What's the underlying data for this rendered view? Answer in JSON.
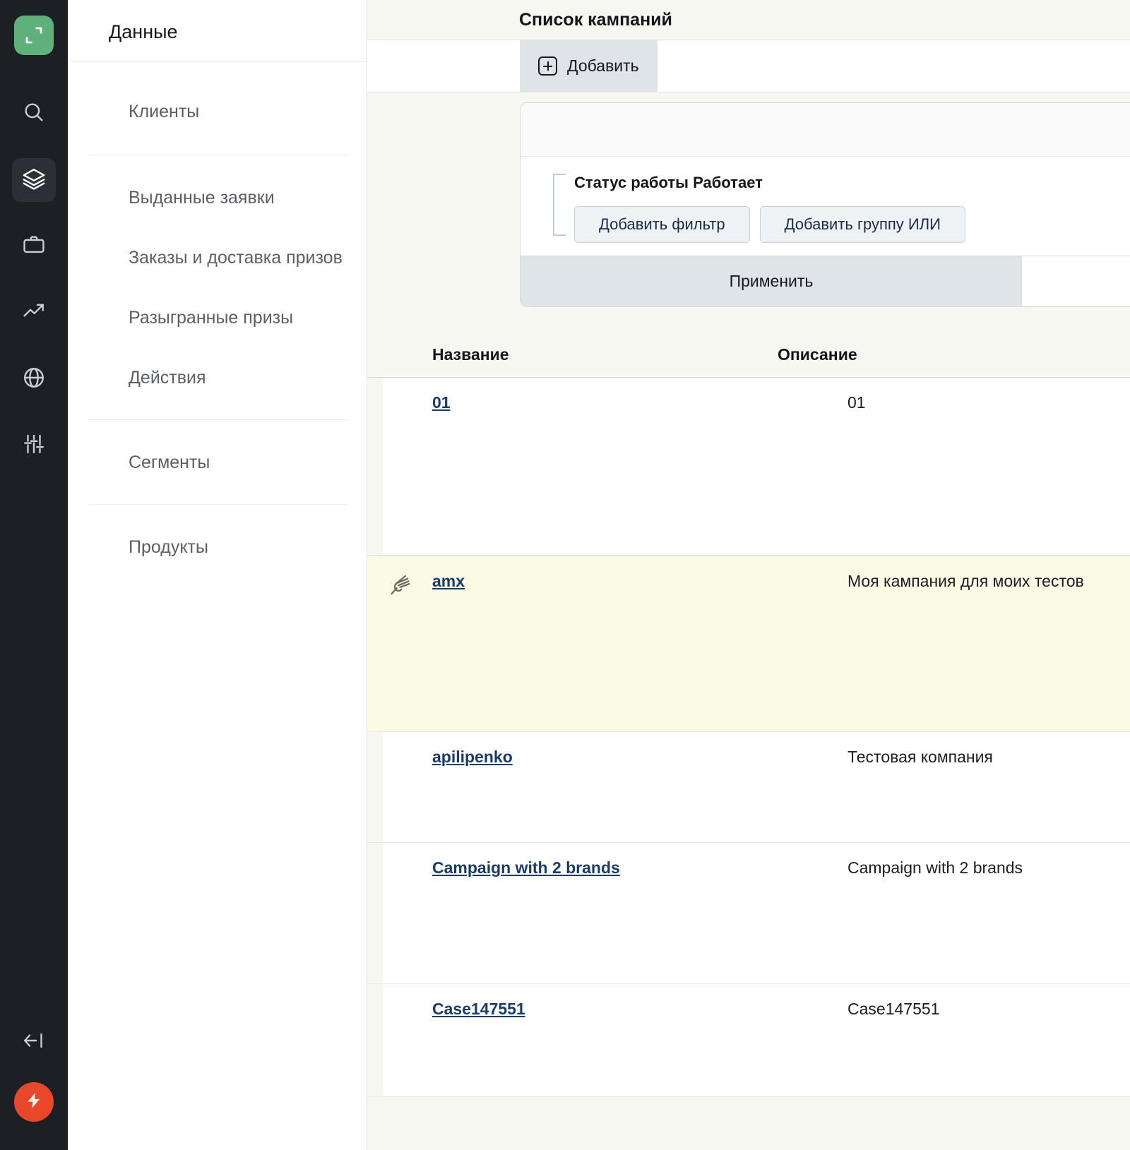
{
  "rail": {
    "logo_icon": "app-logo-icon",
    "items": [
      {
        "icon": "search-icon",
        "active": false
      },
      {
        "icon": "layers-icon",
        "active": true
      },
      {
        "icon": "briefcase-icon",
        "active": false
      },
      {
        "icon": "trending-up-icon",
        "active": false
      },
      {
        "icon": "globe-icon",
        "active": false
      },
      {
        "icon": "sliders-icon",
        "active": false
      }
    ],
    "collapse_icon": "collapse-left-icon",
    "fab_icon": "lightning-bolt-icon"
  },
  "nav": {
    "title": "Данные",
    "groups": [
      {
        "items": [
          {
            "label": "Клиенты"
          }
        ]
      },
      {
        "items": [
          {
            "label": "Выданные заявки"
          },
          {
            "label": "Заказы и доставка призов"
          },
          {
            "label": "Разыгранные призы"
          },
          {
            "label": "Действия"
          }
        ]
      },
      {
        "items": [
          {
            "label": "Сегменты"
          }
        ]
      },
      {
        "items": [
          {
            "label": "Продукты"
          }
        ]
      }
    ]
  },
  "page": {
    "title": "Список кампаний",
    "add_button": "Добавить",
    "add_icon": "plus-square-icon"
  },
  "filter": {
    "status_label": "Статус работы Работает",
    "add_filter_button": "Добавить фильтр",
    "add_or_group_button": "Добавить группу ИЛИ",
    "apply_button": "Применить"
  },
  "table": {
    "columns": [
      {
        "key": "name",
        "label": "Название"
      },
      {
        "key": "description",
        "label": "Описание"
      }
    ],
    "rows": [
      {
        "name": "01",
        "description": "01",
        "highlighted": false,
        "icon": null
      },
      {
        "name": "amx",
        "description": "Моя кампания для моих тестов",
        "highlighted": true,
        "icon": "pen-nib-icon"
      },
      {
        "name": "apilipenko",
        "description": "Тестовая компания",
        "highlighted": false,
        "icon": null
      },
      {
        "name": "Campaign with 2 brands",
        "description": "Campaign with 2 brands",
        "highlighted": false,
        "icon": null
      },
      {
        "name": "Case147551",
        "description": "Case147551",
        "highlighted": false,
        "icon": null
      }
    ]
  },
  "colors": {
    "rail_bg": "#1c1f23",
    "logo_green": "#5fb07a",
    "fab_red": "#e8472a",
    "page_bg": "#f7f7f2",
    "highlight_row": "#fbfae4",
    "link": "#1a3c66",
    "button_bg": "#dfe4e9"
  }
}
